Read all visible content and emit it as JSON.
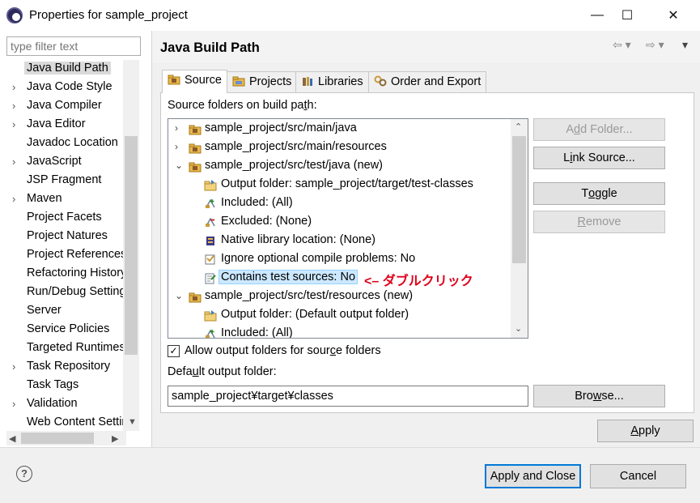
{
  "window": {
    "title": "Properties for sample_project",
    "minimize_glyph": "—",
    "maximize_glyph": "☐",
    "close_glyph": "✕"
  },
  "filter": {
    "placeholder": "type filter text"
  },
  "nav": {
    "items": [
      {
        "label": "Java Build Path",
        "expandable": false,
        "selected": true
      },
      {
        "label": "Java Code Style",
        "expandable": true
      },
      {
        "label": "Java Compiler",
        "expandable": true
      },
      {
        "label": "Java Editor",
        "expandable": true
      },
      {
        "label": "Javadoc Location",
        "expandable": false
      },
      {
        "label": "JavaScript",
        "expandable": true
      },
      {
        "label": "JSP Fragment",
        "expandable": false
      },
      {
        "label": "Maven",
        "expandable": true
      },
      {
        "label": "Project Facets",
        "expandable": false
      },
      {
        "label": "Project Natures",
        "expandable": false
      },
      {
        "label": "Project References",
        "expandable": false
      },
      {
        "label": "Refactoring History",
        "expandable": false
      },
      {
        "label": "Run/Debug Settings",
        "expandable": false
      },
      {
        "label": "Server",
        "expandable": false
      },
      {
        "label": "Service Policies",
        "expandable": false
      },
      {
        "label": "Targeted Runtimes",
        "expandable": false
      },
      {
        "label": "Task Repository",
        "expandable": true
      },
      {
        "label": "Task Tags",
        "expandable": false
      },
      {
        "label": "Validation",
        "expandable": true
      },
      {
        "label": "Web Content Settings",
        "expandable": false
      }
    ]
  },
  "panel": {
    "title": "Java Build Path",
    "tabs": [
      "Source",
      "Projects",
      "Libraries",
      "Order and Export"
    ],
    "source_label_pre": "Source folders on build pa",
    "source_label_ul": "t",
    "source_label_post": "h:",
    "tree": [
      {
        "label": "sample_project/src/main/java",
        "level": 0,
        "exp": "›",
        "icon": "pkg-folder"
      },
      {
        "label": "sample_project/src/main/resources",
        "level": 0,
        "exp": "›",
        "icon": "pkg-folder"
      },
      {
        "label": "sample_project/src/test/java (new)",
        "level": 0,
        "exp": "⌄",
        "icon": "pkg-folder"
      },
      {
        "label": "Output folder: sample_project/target/test-classes",
        "level": 1,
        "icon": "output-folder"
      },
      {
        "label": "Included: (All)",
        "level": 1,
        "icon": "included"
      },
      {
        "label": "Excluded: (None)",
        "level": 1,
        "icon": "excluded"
      },
      {
        "label": "Native library location: (None)",
        "level": 1,
        "icon": "native-lib"
      },
      {
        "label": "Ignore optional compile problems: No",
        "level": 1,
        "icon": "ignore"
      },
      {
        "label": "Contains test sources: No",
        "level": 1,
        "icon": "test-src",
        "selected": true
      },
      {
        "label": "sample_project/src/test/resources (new)",
        "level": 0,
        "exp": "⌄",
        "icon": "pkg-folder"
      },
      {
        "label": "Output folder: (Default output folder)",
        "level": 1,
        "icon": "output-folder"
      },
      {
        "label": "Included: (All)",
        "level": 1,
        "icon": "included"
      }
    ],
    "annotation": "<– ダブルクリック",
    "buttons": {
      "add_folder": {
        "pre": "A",
        "ul": "d",
        "post": "d Folder..."
      },
      "link_source": {
        "pre": "L",
        "ul": "i",
        "post": "nk Source..."
      },
      "toggle": {
        "pre": "T",
        "ul": "o",
        "post": "ggle"
      },
      "remove": {
        "pre": "",
        "ul": "R",
        "post": "emove"
      },
      "browse": {
        "pre": "Bro",
        "ul": "w",
        "post": "se..."
      }
    },
    "allow_output_pre": "Allow output folders for sour",
    "allow_output_ul": "c",
    "allow_output_post": "e folders",
    "allow_output_checked": "✓",
    "default_output_pre": "Defa",
    "default_output_ul": "u",
    "default_output_post": "lt output folder:",
    "default_output_value": "sample_project¥target¥classes"
  },
  "footer": {
    "apply_pre": "",
    "apply_ul": "A",
    "apply_post": "pply",
    "apply_close": "Apply and Close",
    "cancel": "Cancel",
    "help_glyph": "?"
  },
  "colors": {
    "annotation": "#e0001b",
    "selection_bg": "#cce8ff",
    "primary_border": "#0078d7"
  }
}
